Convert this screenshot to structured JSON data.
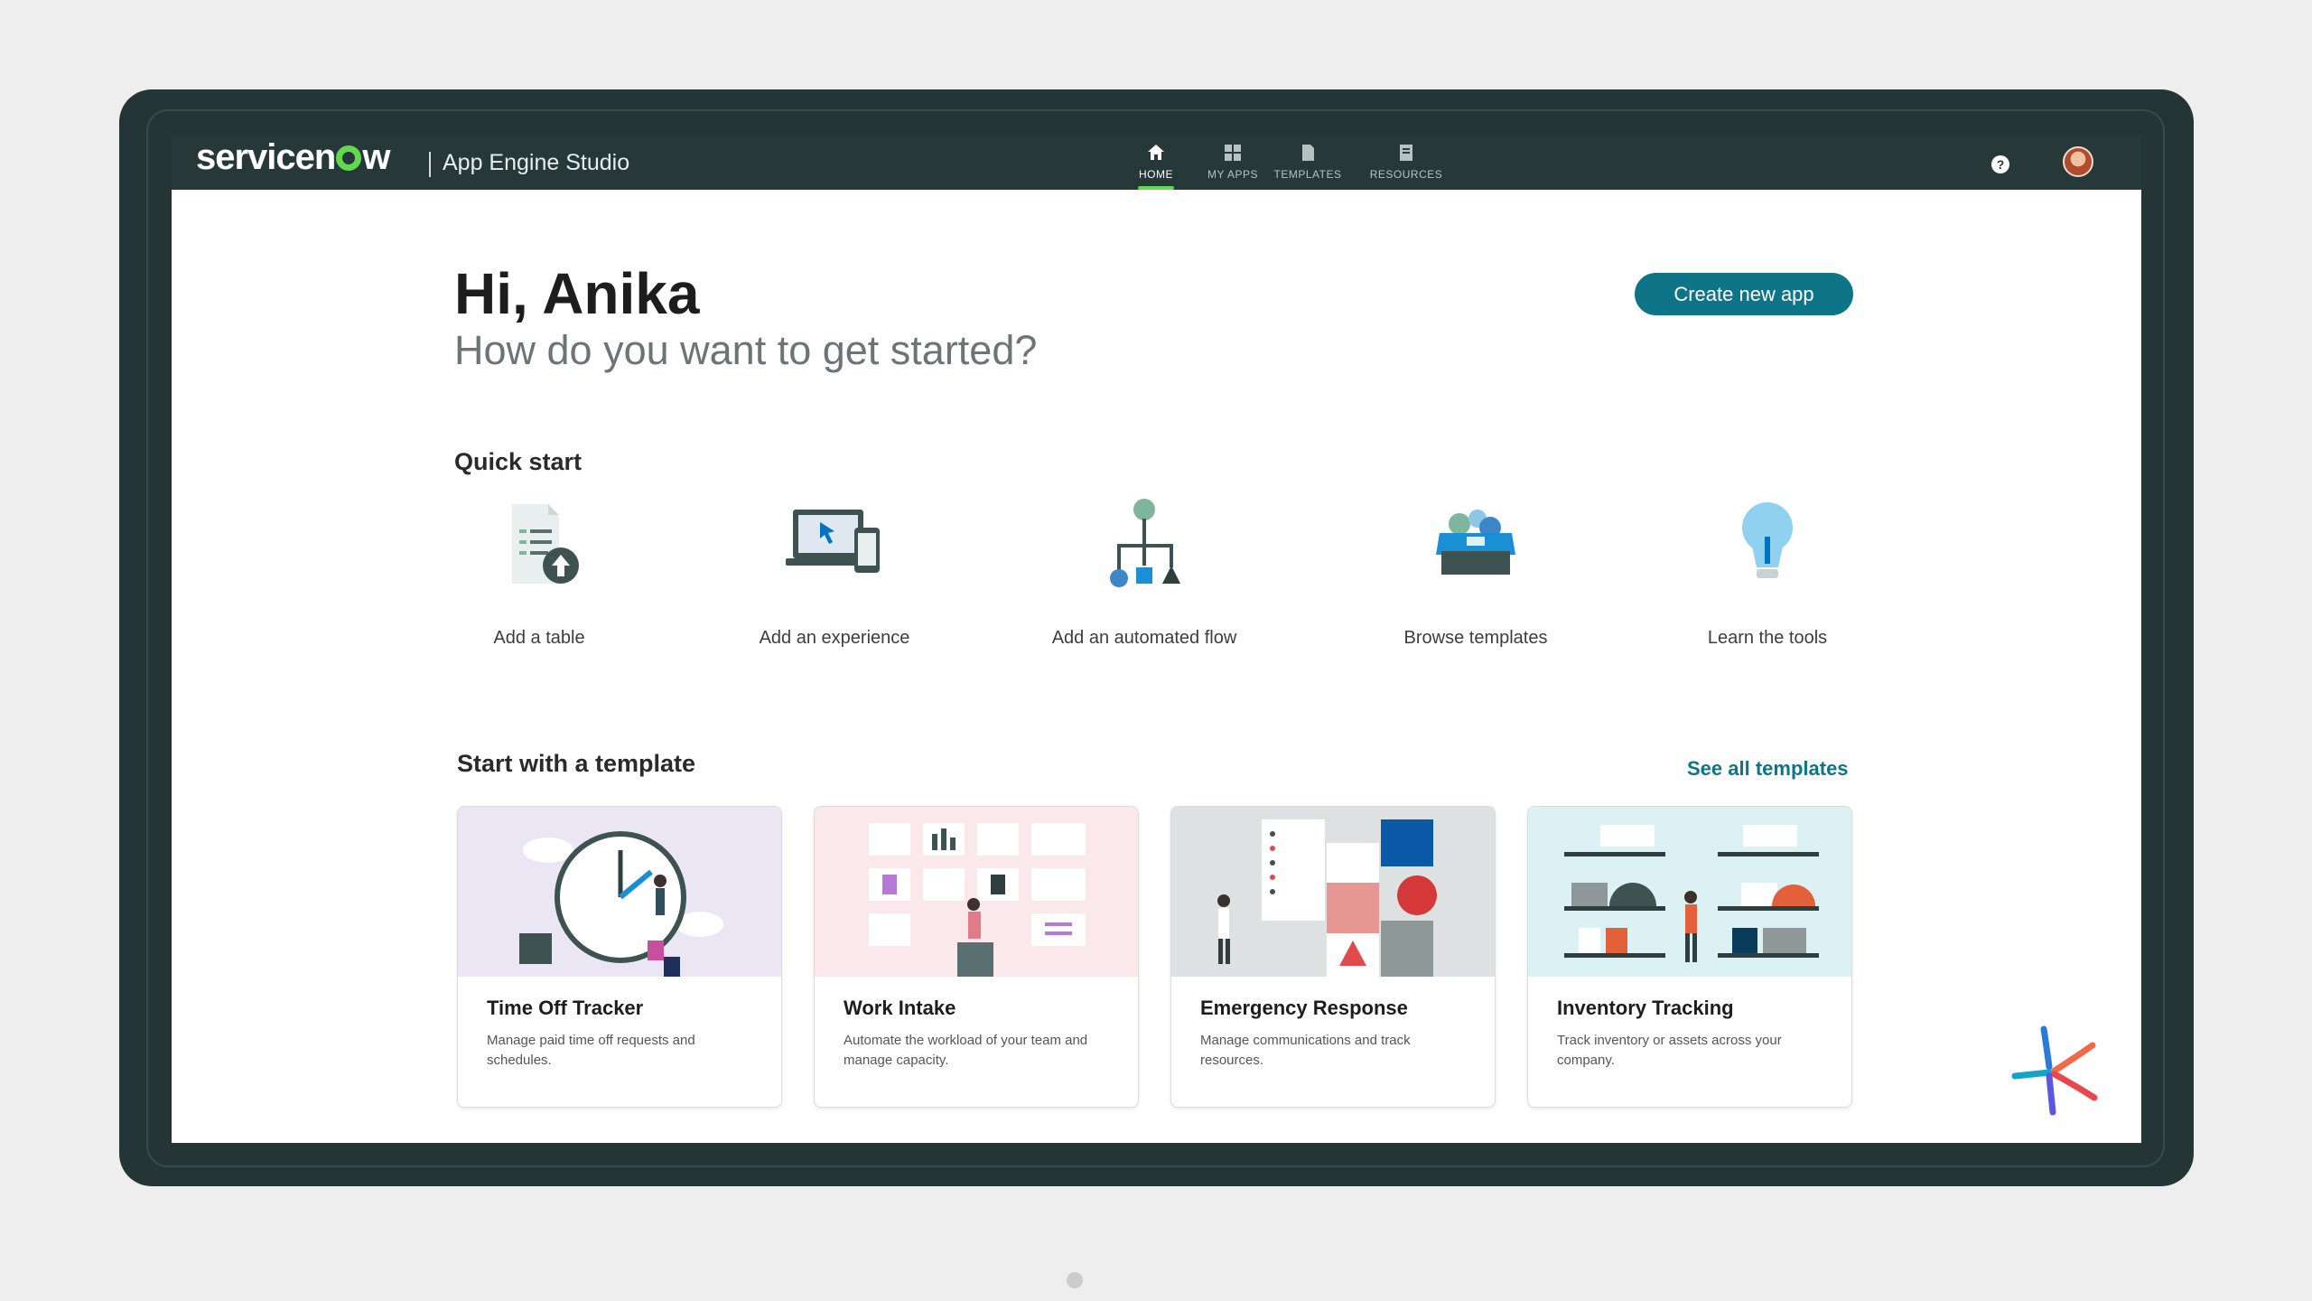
{
  "brand": {
    "logo_pre": "servicen",
    "logo_post": "w",
    "product": "App Engine Studio",
    "accent": "#62d84e"
  },
  "nav": {
    "home": "HOME",
    "my_apps": "MY APPS",
    "templates": "TEMPLATES",
    "resources": "RESOURCES",
    "active": "home"
  },
  "header": {
    "help": "?",
    "avatar_icon": "user-avatar"
  },
  "hero": {
    "greeting": "Hi, Anika",
    "subtitle": "How do you want to get started?",
    "cta": "Create new app",
    "cta_color": "#0e7487"
  },
  "quick_start": {
    "title": "Quick start",
    "items": [
      {
        "label": "Add a table",
        "icon": "table-upload-icon"
      },
      {
        "label": "Add an experience",
        "icon": "devices-icon"
      },
      {
        "label": "Add an automated flow",
        "icon": "flow-icon"
      },
      {
        "label": "Browse templates",
        "icon": "templates-box-icon"
      },
      {
        "label": "Learn the tools",
        "icon": "lightbulb-icon"
      }
    ]
  },
  "templates": {
    "title": "Start with a template",
    "see_all": "See all templates",
    "cards": [
      {
        "title": "Time Off Tracker",
        "desc": "Manage paid time off requests and schedules.",
        "bg": "#ebe6f3"
      },
      {
        "title": "Work Intake",
        "desc": "Automate the workload of your team and manage capacity.",
        "bg": "#fbe8ea"
      },
      {
        "title": "Emergency Response",
        "desc": "Manage communications and track resources.",
        "bg": "#dde1e1"
      },
      {
        "title": "Inventory Tracking",
        "desc": "Track inventory or assets across your company.",
        "bg": "#dcf1f3"
      }
    ]
  }
}
